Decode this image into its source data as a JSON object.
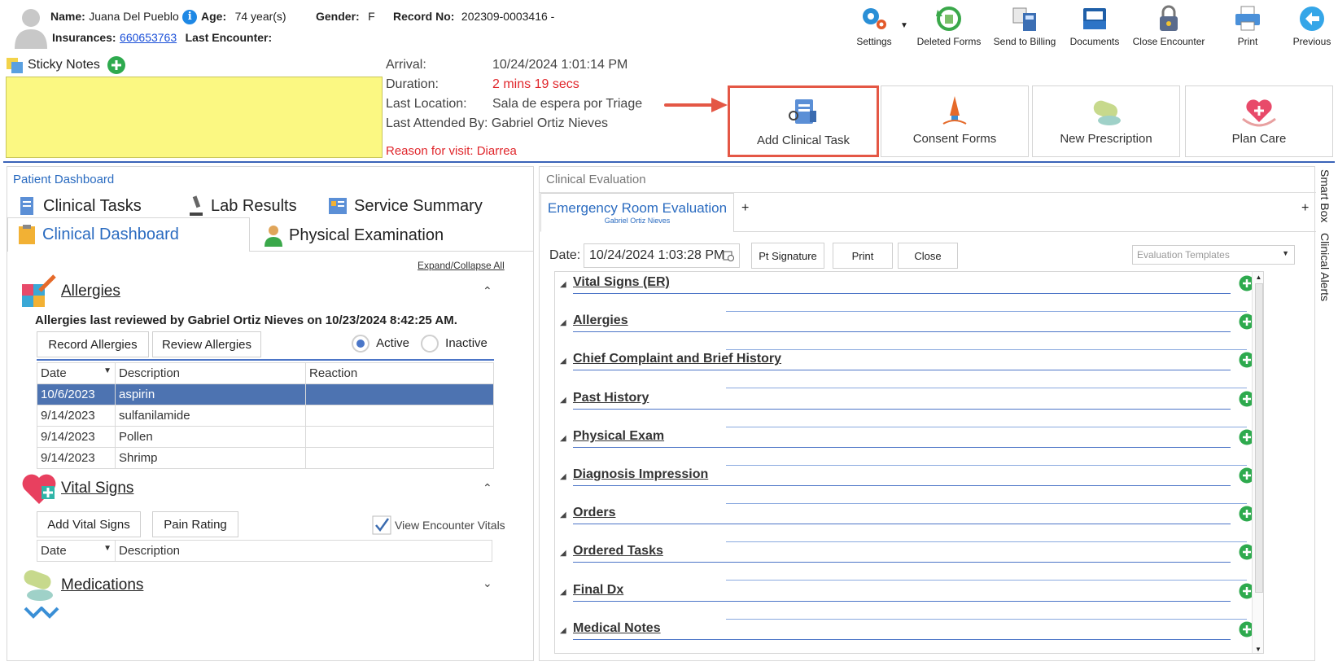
{
  "patient": {
    "name_label": "Name:",
    "name": "Juana Del Pueblo",
    "age_label": "Age:",
    "age": "74 year(s)",
    "gender_label": "Gender:",
    "gender": "F",
    "record_label": "Record No:",
    "record": "202309-0003416 -",
    "insurances_label": "Insurances:",
    "insurance": "660653763",
    "last_encounter_label": "Last Encounter:"
  },
  "toolbar": {
    "settings": "Settings",
    "deleted_forms": "Deleted Forms",
    "send_to_billing": "Send to Billing",
    "documents": "Documents",
    "close_encounter": "Close Encounter",
    "print": "Print",
    "previous": "Previous"
  },
  "sticky": {
    "label": "Sticky Notes"
  },
  "arrival": {
    "arrival_label": "Arrival:",
    "arrival_value": "10/24/2024 1:01:14 PM",
    "duration_label": "Duration:",
    "duration_value": "2 mins 19 secs",
    "location_label": "Last Location:",
    "location_value": "Sala de espera por Triage",
    "attended_label": "Last Attended By:",
    "attended_value": "Gabriel Ortiz Nieves",
    "reason": "Reason for visit: Diarrea"
  },
  "tiles": {
    "add_clinical_task": "Add Clinical Task",
    "consent_forms": "Consent Forms",
    "new_prescription": "New Prescription",
    "plan_care": "Plan Care"
  },
  "left": {
    "header": "Patient Dashboard",
    "tabs": {
      "clinical_tasks": "Clinical Tasks",
      "lab_results": "Lab Results",
      "service_summary": "Service Summary",
      "clinical_dashboard": "Clinical Dashboard",
      "physical_examination": "Physical Examination"
    },
    "expand_collapse": "Expand/Collapse All",
    "allergies": {
      "title": "Allergies",
      "review_note": "Allergies last reviewed by Gabriel Ortiz Nieves on 10/23/2024 8:42:25 AM.",
      "record_btn": "Record Allergies",
      "review_btn": "Review Allergies",
      "active": "Active",
      "inactive": "Inactive",
      "columns": [
        "Date",
        "Description",
        "Reaction"
      ],
      "rows": [
        {
          "date": "10/6/2023",
          "description": "aspirin",
          "reaction": ""
        },
        {
          "date": "9/14/2023",
          "description": "sulfanilamide",
          "reaction": ""
        },
        {
          "date": "9/14/2023",
          "description": "Pollen",
          "reaction": ""
        },
        {
          "date": "9/14/2023",
          "description": "Shrimp",
          "reaction": ""
        }
      ]
    },
    "vitals": {
      "title": "Vital Signs",
      "add_btn": "Add Vital Signs",
      "pain_btn": "Pain Rating",
      "view_encounter": "View Encounter Vitals",
      "columns": [
        "Date",
        "Description"
      ]
    },
    "medications": {
      "title": "Medications"
    }
  },
  "right": {
    "header": "Clinical Evaluation",
    "tab_title": "Emergency Room Evaluation",
    "tab_sub": "Gabriel Ortiz Nieves",
    "plus": "+",
    "date_label": "Date:",
    "date_value": "10/24/2024 1:03:28 PM",
    "pt_signature": "Pt Signature",
    "print": "Print",
    "close": "Close",
    "templates_placeholder": "Evaluation Templates",
    "sections": [
      "Vital Signs (ER)",
      "Allergies",
      "Chief Complaint and Brief History",
      "Past History",
      "Physical Exam",
      "Diagnosis Impression",
      "Orders",
      "Ordered Tasks",
      "Final Dx",
      "Medical Notes"
    ]
  },
  "side": {
    "smart_box": "Smart Box",
    "clinical_alerts": "Clinical Alerts"
  }
}
